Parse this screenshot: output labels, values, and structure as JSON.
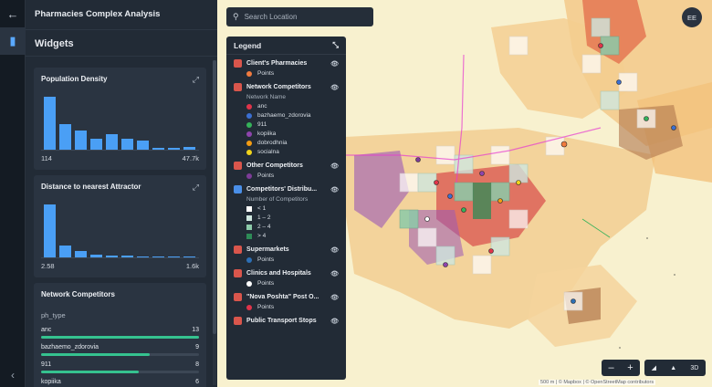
{
  "app": {
    "title": "Pharmacies Complex Analysis"
  },
  "panel": {
    "widgets_label": "Widgets"
  },
  "widgets": [
    {
      "title": "Population Density",
      "min_label": "114",
      "max_label": "47.7k",
      "bins": [
        1.0,
        0.48,
        0.37,
        0.2,
        0.29,
        0.2,
        0.18,
        0.03,
        0.04,
        0.06
      ]
    },
    {
      "title": "Distance to nearest Attractor",
      "min_label": "2.58",
      "max_label": "1.6k",
      "bins": [
        1.0,
        0.22,
        0.12,
        0.05,
        0.04,
        0.03,
        0.02,
        0.02,
        0.02,
        0.02
      ]
    }
  ],
  "network_widget": {
    "title": "Network Competitors",
    "field": "ph_type",
    "rows": [
      {
        "name": "anc",
        "value": "13",
        "share": 1.0
      },
      {
        "name": "bazhaemo_zdorovia",
        "value": "9",
        "share": 0.69
      },
      {
        "name": "911",
        "value": "8",
        "share": 0.62
      },
      {
        "name": "kopiika",
        "value": "6",
        "share": 0.46
      }
    ]
  },
  "search": {
    "placeholder": "Search Location"
  },
  "user": {
    "initials": "EE"
  },
  "legend": {
    "title": "Legend",
    "sections": [
      {
        "title": "Client's Pharmacies",
        "items": [
          {
            "label": "Points",
            "color": "#f07b3f"
          }
        ]
      },
      {
        "title": "Network Competitors",
        "subtitle": "Network Name",
        "items": [
          {
            "label": "anc",
            "color": "#e0344a"
          },
          {
            "label": "bazhaemo_zdorovia",
            "color": "#3b6fd1"
          },
          {
            "label": "911",
            "color": "#35b25a"
          },
          {
            "label": "kopiika",
            "color": "#8e44ad"
          },
          {
            "label": "dobrodhnia",
            "color": "#f39c12"
          },
          {
            "label": "socialna",
            "color": "#f1d41c"
          }
        ]
      },
      {
        "title": "Other Competitors",
        "items": [
          {
            "label": "Points",
            "color": "#7d3c98"
          }
        ]
      },
      {
        "title": "Competitors' Distribu...",
        "subtitle": "Number of Competitors",
        "shape": "square",
        "items": [
          {
            "label": "< 1",
            "color": "#ffffff"
          },
          {
            "label": "1 – 2",
            "color": "#cfe7e0"
          },
          {
            "label": "2 – 4",
            "color": "#8ccaa9"
          },
          {
            "label": "> 4",
            "color": "#2e8b57"
          }
        ]
      },
      {
        "title": "Supermarkets",
        "items": [
          {
            "label": "Points",
            "color": "#2d6fb5"
          }
        ]
      },
      {
        "title": "Clinics and Hospitals",
        "items": [
          {
            "label": "Points",
            "color": "#ffffff"
          }
        ]
      },
      {
        "title": "\"Nova Poshta\" Post O...",
        "items": [
          {
            "label": "Points",
            "color": "#e0344a"
          }
        ]
      },
      {
        "title": "Public Transport Stops",
        "items": []
      }
    ]
  },
  "map_controls": {
    "zoom_out": "–",
    "zoom_in": "+",
    "view_3d": "3D"
  },
  "attribution": "500 m | © Mapbox | © OpenStreetMap contributors"
}
